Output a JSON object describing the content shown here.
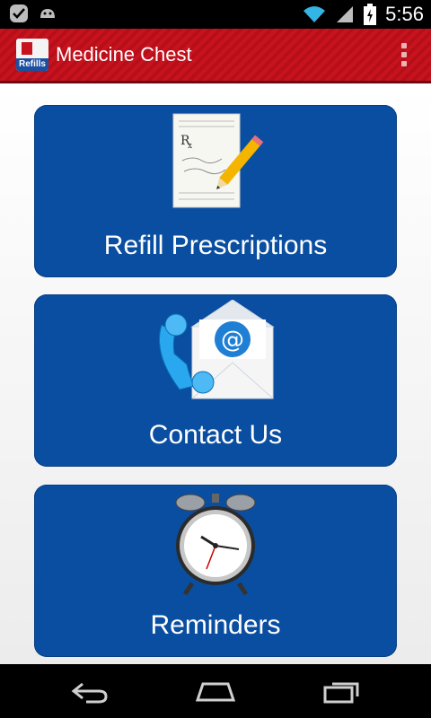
{
  "status_bar": {
    "time": "5:56",
    "icons": [
      "checkmark-icon",
      "android-icon",
      "wifi-icon",
      "signal-icon",
      "battery-icon"
    ]
  },
  "action_bar": {
    "app_icon_text": "Refills",
    "title": "Medicine Chest",
    "overflow_icon": "overflow-menu-icon",
    "color": "#c8131f"
  },
  "tiles": [
    {
      "label": "Refill Prescriptions",
      "icon": "prescription-pad-icon"
    },
    {
      "label": "Contact Us",
      "icon": "phone-email-icon"
    },
    {
      "label": "Reminders",
      "icon": "alarm-clock-icon"
    }
  ],
  "nav_bar": {
    "buttons": [
      "back-icon",
      "home-icon",
      "recents-icon"
    ]
  },
  "colors": {
    "tile_blue": "#0a4ea1",
    "action_bar_red": "#c8131f"
  }
}
